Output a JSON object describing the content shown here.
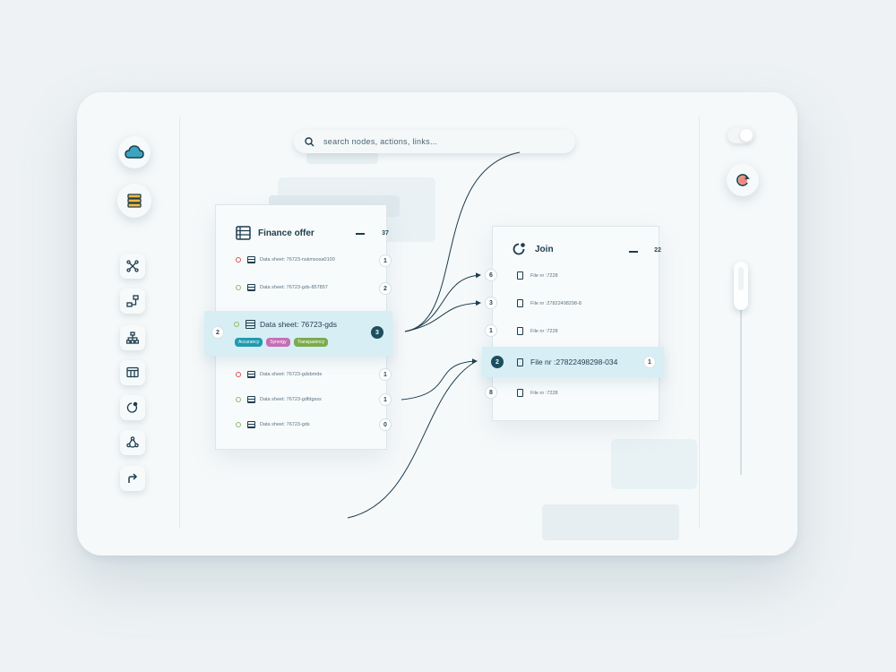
{
  "search": {
    "placeholder": "search nodes, actions, links..."
  },
  "finance_panel": {
    "title": "Finance offer",
    "count": "37",
    "rows": [
      {
        "label": "Data sheet: 76723-nskmsosa0100",
        "count": "1",
        "status": "red"
      },
      {
        "label": "Data sheet: 76723-gds-857857",
        "count": "2",
        "status": "green"
      },
      {
        "label": "Data sheet: 76723-gdsbmde",
        "count": "1",
        "status": "red"
      },
      {
        "label": "Data sheet: 76723-gdfdgsss",
        "count": "1",
        "status": "green"
      },
      {
        "label": "Data sheet: 76723-gds",
        "count": "0",
        "status": "green"
      }
    ],
    "selected": {
      "label": "Data sheet: 76723-gds",
      "left_count": "2",
      "count": "3",
      "tags": [
        {
          "label": "Accurancy",
          "color": "#1f9bb0"
        },
        {
          "label": "Synergy",
          "color": "#c56fb6"
        },
        {
          "label": "Transparency",
          "color": "#7cab4d"
        }
      ]
    }
  },
  "join_panel": {
    "title": "Join",
    "count": "22",
    "rows": [
      {
        "label": "File nr :7228",
        "left_count": "6"
      },
      {
        "label": "File nr :27822498298-8",
        "left_count": "3"
      },
      {
        "label": "File nr :7228",
        "left_count": "1"
      },
      {
        "label": "File nr :7228",
        "left_count": "8"
      }
    ],
    "selected": {
      "label": "File nr :27822498298-034",
      "left_count": "2",
      "count": "1"
    }
  },
  "colors": {
    "accent": "#1d4f5e",
    "highlight": "#d8eef5",
    "red": "#d9534f",
    "green": "#8fb96b"
  }
}
